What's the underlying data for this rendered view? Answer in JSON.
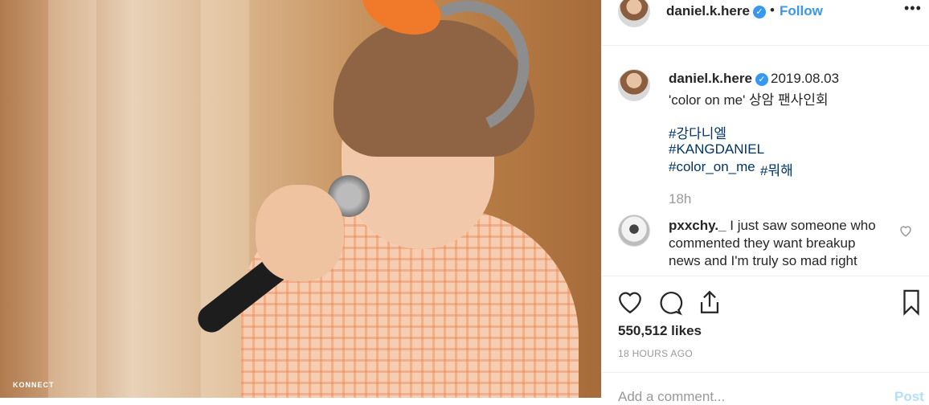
{
  "photo": {
    "watermark": "KONNECT"
  },
  "header": {
    "username": "daniel.k.here",
    "verified_icon": "✓",
    "separator": "•",
    "follow_label": "Follow",
    "more_icon": "•••"
  },
  "caption": {
    "username": "daniel.k.here",
    "date": "2019.08.03",
    "line1": "'color on me' 상암 팬사인회",
    "tags": [
      "#강다니엘",
      "#KANGDANIEL",
      "#color_on_me",
      "#뭐해"
    ],
    "time": "18h"
  },
  "comment": {
    "username": "pxxchy._",
    "text": "I just saw someone who commented they want breakup news and I'm truly so mad right"
  },
  "actions": {
    "likes": "550,512 likes",
    "ago": "18 HOURS AGO"
  },
  "add_comment": {
    "placeholder": "Add a comment...",
    "post_label": "Post"
  },
  "colors": {
    "accent": "#3897f0",
    "hashtag": "#003569",
    "muted": "#999999"
  }
}
